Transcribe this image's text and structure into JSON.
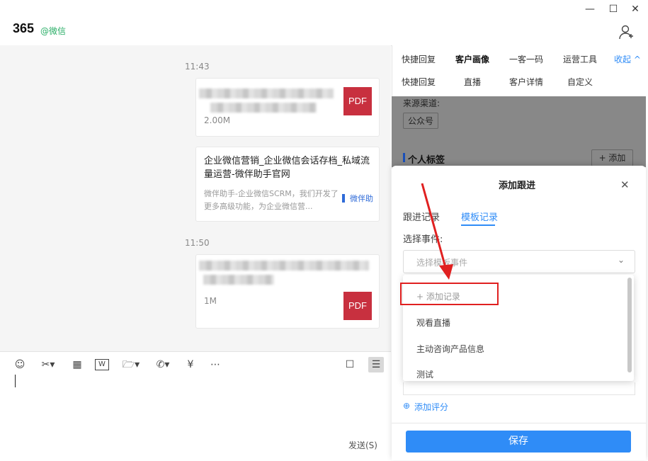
{
  "header": {
    "title": "365",
    "subtitle": "@微信",
    "window_buttons": [
      "minimize-icon",
      "maximize-icon",
      "close-icon"
    ]
  },
  "chat": {
    "messages": [
      {
        "time": "11:43",
        "type": "file",
        "size": "2.00M",
        "badge": "PDF"
      },
      {
        "type": "link",
        "title": "企业微信营销_企业微信会话存档_私域流量运营-微伴助手官网",
        "desc": "微伴助手-企业微信SCRM，我们开发了更多高级功能，为企业微信营...",
        "source": "微伴助"
      },
      {
        "time": "11:50",
        "type": "file",
        "size": "1M",
        "badge": "PDF"
      }
    ]
  },
  "input": {
    "send_label": "发送(S)"
  },
  "panel": {
    "tabs_row1": [
      "快捷回复",
      "客户画像",
      "一客一码",
      "运营工具"
    ],
    "collapse_label": "收起 ^",
    "tabs_row2": [
      "快捷回复",
      "直播",
      "客户详情",
      "自定义"
    ],
    "source_label": "来源渠道:",
    "source_tag": "公众号",
    "personal_tags_label": "个人标签",
    "add_tag_label": "+ 添加"
  },
  "modal": {
    "title": "添加跟进",
    "tabs": [
      "跟进记录",
      "模板记录"
    ],
    "active_tab": "模板记录",
    "event_label": "选择事件:",
    "event_placeholder": "选择模板事件",
    "dropdown_options": [
      "+ 添加记录",
      "观看直播",
      "主动咨询产品信息",
      "测试"
    ],
    "add_rating_label": "添加评分",
    "save_label": "保存"
  },
  "colors": {
    "accent": "#2f8cf7",
    "pdf": "#c8303f",
    "highlight": "#e02020",
    "wechat_green": "#2aae67"
  }
}
